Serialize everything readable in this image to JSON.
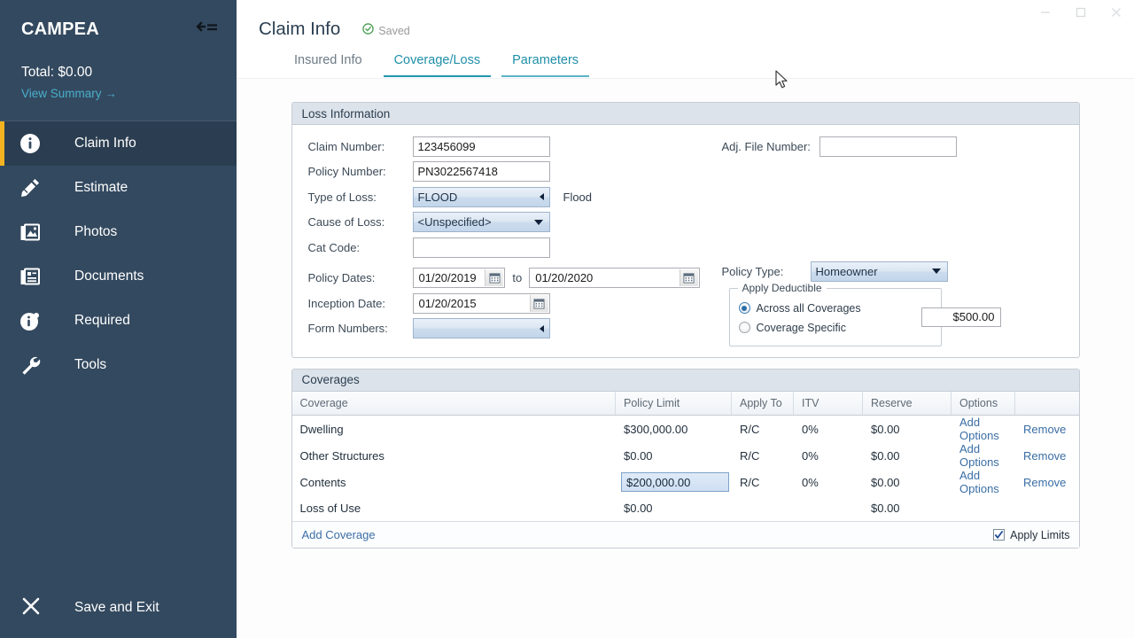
{
  "window": {
    "controls": [
      {
        "name": "minimize",
        "glyph": "minimize-icon"
      },
      {
        "name": "maximize",
        "glyph": "maximize-icon"
      },
      {
        "name": "close",
        "glyph": "close-icon"
      }
    ]
  },
  "sidebar": {
    "brand": "CAMPEA",
    "collapse_icon": "collapse-sidebar-icon",
    "total_label": "Total: $0.00",
    "view_summary": "View Summary  →",
    "accent_color": "#f5b321",
    "background_color": "#33495f",
    "active_background": "#2b3e51",
    "items": [
      {
        "label": "Claim Info",
        "icon": "info-circle-icon",
        "active": true
      },
      {
        "label": "Estimate",
        "icon": "pencil-ruler-icon",
        "active": false
      },
      {
        "label": "Photos",
        "icon": "photos-icon",
        "active": false
      },
      {
        "label": "Documents",
        "icon": "documents-icon",
        "active": false
      },
      {
        "label": "Required",
        "icon": "info-required-icon",
        "active": false
      },
      {
        "label": "Tools",
        "icon": "wrench-icon",
        "active": false
      }
    ],
    "footer": {
      "label": "Save and Exit",
      "icon": "close-x-icon"
    }
  },
  "header": {
    "title": "Claim Info",
    "status": {
      "text": "Saved",
      "icon": "check-circle-icon",
      "color": "#4a9e53"
    }
  },
  "tabs": [
    {
      "label": "Insured Info",
      "state": "inactive"
    },
    {
      "label": "Coverage/Loss",
      "state": "active"
    },
    {
      "label": "Parameters",
      "state": "hovered"
    }
  ],
  "loss_information": {
    "panel_title": "Loss Information",
    "fields": {
      "claim_number_label": "Claim Number:",
      "claim_number_value": "123456099",
      "policy_number_label": "Policy Number:",
      "policy_number_value": "PN3022567418",
      "type_of_loss_label": "Type of Loss:",
      "type_of_loss_value": "FLOOD",
      "type_of_loss_note": "Flood",
      "cause_of_loss_label": "Cause of Loss:",
      "cause_of_loss_value": "<Unspecified>",
      "cat_code_label": "Cat Code:",
      "cat_code_value": "",
      "policy_dates_label": "Policy Dates:",
      "policy_date_from": "01/20/2019",
      "policy_dates_to_word": "to",
      "policy_date_to": "01/20/2020",
      "inception_date_label": "Inception Date:",
      "inception_date_value": "01/20/2015",
      "form_numbers_label": "Form Numbers:",
      "form_numbers_value": "",
      "adj_file_number_label": "Adj. File Number:",
      "adj_file_number_value": "",
      "policy_type_label": "Policy Type:",
      "policy_type_value": "Homeowner"
    },
    "apply_deductible": {
      "legend": "Apply Deductible",
      "option_all": "Across all Coverages",
      "option_specific": "Coverage Specific",
      "selected": "Across all Coverages",
      "amount": "$500.00"
    }
  },
  "coverages": {
    "panel_title": "Coverages",
    "columns": [
      "Coverage",
      "Policy Limit",
      "Apply To",
      "ITV",
      "Reserve",
      "Options",
      ""
    ],
    "rows": [
      {
        "coverage": "Dwelling",
        "policy_limit": "$300,000.00",
        "apply_to": "R/C",
        "itv": "0%",
        "reserve": "$0.00",
        "options": "Add Options",
        "remove": "Remove",
        "editing": false
      },
      {
        "coverage": "Other Structures",
        "policy_limit": "$0.00",
        "apply_to": "R/C",
        "itv": "0%",
        "reserve": "$0.00",
        "options": "Add Options",
        "remove": "Remove",
        "editing": false
      },
      {
        "coverage": "Contents",
        "policy_limit": "$200,000.00",
        "apply_to": "R/C",
        "itv": "0%",
        "reserve": "$0.00",
        "options": "Add Options",
        "remove": "Remove",
        "editing": true
      },
      {
        "coverage": "Loss of Use",
        "policy_limit": "$0.00",
        "apply_to": "",
        "itv": "",
        "reserve": "$0.00",
        "options": "",
        "remove": "",
        "editing": false
      }
    ],
    "footer": {
      "add_coverage": "Add Coverage",
      "apply_limits_label": "Apply Limits",
      "apply_limits_checked": true
    }
  }
}
